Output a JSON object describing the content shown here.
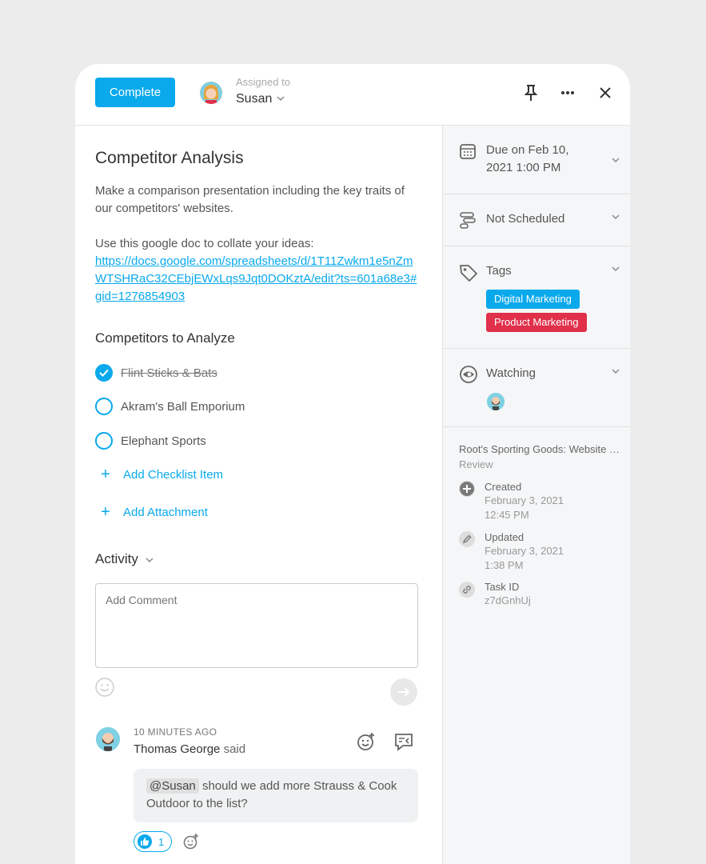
{
  "header": {
    "complete_label": "Complete",
    "assigned_label": "Assigned to",
    "assignee": "Susan",
    "icons": [
      "pin-icon",
      "more-icon",
      "close-icon"
    ]
  },
  "task": {
    "title": "Competitor Analysis",
    "description": "Make a comparison presentation including the key traits of our competitors' websites.",
    "doc_intro": "Use this google doc to collate your ideas:",
    "doc_link": "https://docs.google.com/spreadsheets/d/1T11Zwkm1e5nZmWTSHRaC32CEbjEWxLqs9Jqt0DOKztA/edit?ts=601a68e3#gid=1276854903"
  },
  "checklist": {
    "title": "Competitors to Analyze",
    "items": [
      {
        "label": "Flint Sticks & Bats",
        "done": true
      },
      {
        "label": "Akram's Ball Emporium",
        "done": false
      },
      {
        "label": "Elephant Sports",
        "done": false
      }
    ],
    "add_item_label": "Add Checklist Item",
    "add_attachment_label": "Add Attachment"
  },
  "activity": {
    "title": "Activity",
    "comment_placeholder": "Add Comment",
    "comment": {
      "time": "10 MINUTES AGO",
      "author": "Thomas George",
      "said": "said",
      "mention": "@Susan",
      "text": "should we add more Strauss & Cook Outdoor to the list?",
      "likes": "1"
    }
  },
  "sidebar": {
    "due_line1": "Due on Feb 10,",
    "due_line2": "2021 1:00 PM",
    "schedule": "Not Scheduled",
    "tags_label": "Tags",
    "tags": [
      {
        "label": "Digital Marketing",
        "color": "#09a9ec"
      },
      {
        "label": "Product Marketing",
        "color": "#e0304a"
      }
    ],
    "watching_label": "Watching",
    "project": "Root's Sporting Goods: Website Redesign",
    "project_sub": "Review",
    "created_label": "Created",
    "created_date": "February 3, 2021",
    "created_time": "12:45 PM",
    "updated_label": "Updated",
    "updated_date": "February 3, 2021",
    "updated_time": "1:38 PM",
    "taskid_label": "Task ID",
    "taskid": "z7dGnhUj"
  },
  "colors": {
    "accent": "#09a9ec",
    "danger": "#e0304a"
  }
}
